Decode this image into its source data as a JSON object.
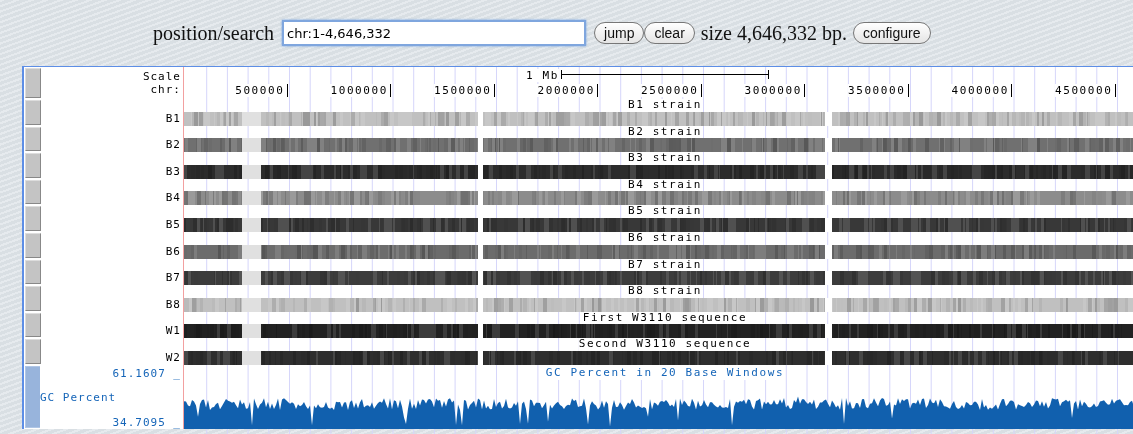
{
  "search": {
    "label": "position/search",
    "value": "chr:1-4,646,332",
    "buttons": [
      "jump",
      "clear"
    ],
    "size": "size 4,646,332 bp.",
    "configure": "configure"
  },
  "ruler": {
    "scale_label": "Scale",
    "chr_label": "chr:",
    "bar_label": "1 Mb",
    "ticks": [
      "500000",
      "1000000",
      "1500000",
      "2000000",
      "2500000",
      "3000000",
      "3500000",
      "4000000",
      "4500000"
    ]
  },
  "tracks": [
    {
      "label": "B1",
      "title": "B1 strain",
      "color": "#c0c0c0"
    },
    {
      "label": "B2",
      "title": "B2 strain",
      "color": "#707070"
    },
    {
      "label": "B3",
      "title": "B3 strain",
      "color": "#2c2c2c"
    },
    {
      "label": "B4",
      "title": "B4 strain",
      "color": "#8c8c8c"
    },
    {
      "label": "B5",
      "title": "B5 strain",
      "color": "#383838"
    },
    {
      "label": "B6",
      "title": "B6 strain",
      "color": "#6c6c6c"
    },
    {
      "label": "B7",
      "title": "B7 strain",
      "color": "#3c3c3c"
    },
    {
      "label": "B8",
      "title": "B8 strain",
      "color": "#c0c0c0"
    },
    {
      "label": "W1",
      "title": "First W3110 sequence",
      "color": "#222222"
    },
    {
      "label": "W2",
      "title": "Second W3110 sequence",
      "color": "#2e2e2e"
    }
  ],
  "gc_track": {
    "label": "GC Percent",
    "title": "GC Percent in 20 Base Windows",
    "max": "61.1607 _",
    "min": "34.7095 _"
  }
}
